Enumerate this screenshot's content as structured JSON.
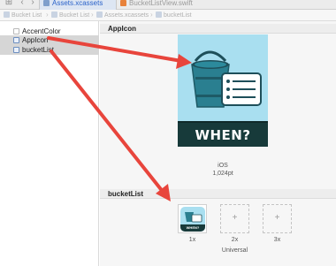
{
  "tabbar": {
    "tabs": [
      {
        "label": "Assets.xcassets",
        "active": true
      },
      {
        "label": "BucketListView.swift",
        "active": false
      }
    ]
  },
  "breadcrumb": [
    "Bucket List",
    "Bucket List",
    "Assets.xcassets",
    "bucketList"
  ],
  "sidebar": {
    "items": [
      {
        "label": "AccentColor"
      },
      {
        "label": "AppIcon"
      },
      {
        "label": "bucketList"
      }
    ]
  },
  "appicon_section": {
    "title": "AppIcon",
    "banner_text": "WHEN?",
    "platform": "iOS",
    "size": "1,024pt"
  },
  "bucketlist_section": {
    "title": "bucketList",
    "banner_text": "WHEN?",
    "slots": [
      "1x",
      "2x",
      "3x"
    ],
    "scale_caption": "Universal"
  },
  "colors": {
    "arrow": "#e8453c",
    "icon_bg": "#a9dff0",
    "bucket": "#2a7f90",
    "banner": "#173a3a"
  }
}
